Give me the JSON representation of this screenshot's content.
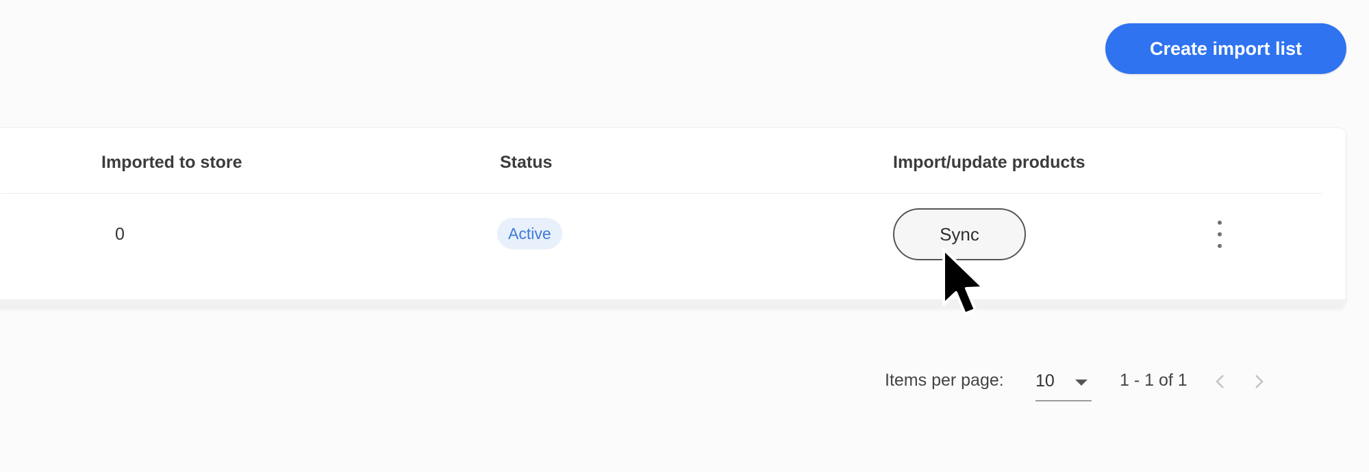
{
  "header": {
    "create_button_label": "Create import list"
  },
  "table": {
    "columns": [
      "Imported to store",
      "Status",
      "Import/update products"
    ],
    "rows": [
      {
        "imported_to_store": "0",
        "status": "Active",
        "action_label": "Sync"
      }
    ]
  },
  "pagination": {
    "items_per_page_label": "Items per page:",
    "items_per_page_value": "10",
    "range_text": "1 - 1 of 1"
  },
  "colors": {
    "primary": "#2f73f0",
    "status_active_bg": "#e8f0fc",
    "status_active_text": "#3e7ad9"
  },
  "icons": {
    "row_menu": "more-vertical-icon",
    "prev": "chevron-left-icon",
    "next": "chevron-right-icon",
    "dropdown": "caret-down-icon"
  }
}
